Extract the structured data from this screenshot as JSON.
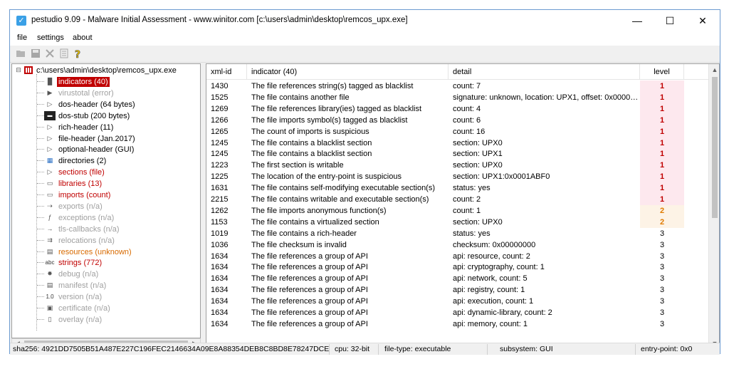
{
  "window": {
    "title": "pestudio 9.09 - Malware Initial Assessment - www.winitor.com [c:\\users\\admin\\desktop\\remcos_upx.exe]",
    "minimize": "—",
    "maximize": "☐",
    "close": "✕"
  },
  "menu": [
    "file",
    "settings",
    "about"
  ],
  "toolbar": {
    "open_icon": "folder-open-icon",
    "save_icon": "save-icon",
    "close_icon": "close-icon",
    "list_icon": "document-icon",
    "help_icon": "help-icon"
  },
  "tree": {
    "root": "c:\\users\\admin\\desktop\\remcos_upx.exe",
    "items": [
      {
        "label": "indicators (40)",
        "color": "red",
        "icon": "bar-icon",
        "selected": true
      },
      {
        "label": "virustotal (error)",
        "color": "grey",
        "icon": "play-icon"
      },
      {
        "label": "dos-header (64 bytes)",
        "color": "black",
        "icon": "arrow-icon"
      },
      {
        "label": "dos-stub (200 bytes)",
        "color": "black",
        "icon": "dos-icon"
      },
      {
        "label": "rich-header (11)",
        "color": "black",
        "icon": "arrow-icon"
      },
      {
        "label": "file-header (Jan.2017)",
        "color": "black",
        "icon": "arrow-icon"
      },
      {
        "label": "optional-header (GUI)",
        "color": "black",
        "icon": "arrow-icon"
      },
      {
        "label": "directories (2)",
        "color": "black",
        "icon": "grid-icon"
      },
      {
        "label": "sections (file)",
        "color": "red",
        "icon": "arrow-icon"
      },
      {
        "label": "libraries (13)",
        "color": "red",
        "icon": "library-icon"
      },
      {
        "label": "imports (count)",
        "color": "red",
        "icon": "library-icon"
      },
      {
        "label": "exports (n/a)",
        "color": "grey",
        "icon": "export-icon"
      },
      {
        "label": "exceptions (n/a)",
        "color": "grey",
        "icon": "exception-icon"
      },
      {
        "label": "tls-callbacks (n/a)",
        "color": "grey",
        "icon": "key-icon"
      },
      {
        "label": "relocations (n/a)",
        "color": "grey",
        "icon": "relocation-icon"
      },
      {
        "label": "resources (unknown)",
        "color": "orange",
        "icon": "resource-icon"
      },
      {
        "label": "strings (772)",
        "color": "red",
        "icon": "abc-icon"
      },
      {
        "label": "debug (n/a)",
        "color": "grey",
        "icon": "bug-icon"
      },
      {
        "label": "manifest (n/a)",
        "color": "grey",
        "icon": "manifest-icon"
      },
      {
        "label": "version (n/a)",
        "color": "grey",
        "icon": "version-icon"
      },
      {
        "label": "certificate (n/a)",
        "color": "grey",
        "icon": "certificate-icon"
      },
      {
        "label": "overlay (n/a)",
        "color": "grey",
        "icon": "page-icon"
      }
    ]
  },
  "table": {
    "columns": [
      "xml-id",
      "indicator (40)",
      "detail",
      "level"
    ],
    "rows": [
      [
        "1430",
        "The file references string(s) tagged as blacklist",
        "count: 7",
        "1"
      ],
      [
        "1525",
        "The file contains another file",
        "signature: unknown, location: UPX1, offset: 0x000061...",
        "1"
      ],
      [
        "1269",
        "The file references library(ies) tagged as blacklist",
        "count: 4",
        "1"
      ],
      [
        "1266",
        "The file imports symbol(s) tagged as blacklist",
        "count: 6",
        "1"
      ],
      [
        "1265",
        "The count of imports is suspicious",
        "count: 16",
        "1"
      ],
      [
        "1245",
        "The file contains a blacklist section",
        "section: UPX0",
        "1"
      ],
      [
        "1245",
        "The file contains a blacklist section",
        "section: UPX1",
        "1"
      ],
      [
        "1223",
        "The first section is writable",
        "section: UPX0",
        "1"
      ],
      [
        "1225",
        "The location of the entry-point is suspicious",
        "section: UPX1:0x0001ABF0",
        "1"
      ],
      [
        "1631",
        "The file contains self-modifying executable section(s)",
        "status: yes",
        "1"
      ],
      [
        "2215",
        "The file contains writable and executable section(s)",
        "count: 2",
        "1"
      ],
      [
        "1262",
        "The file imports anonymous function(s)",
        "count: 1",
        "2"
      ],
      [
        "1153",
        "The file contains a virtualized section",
        "section: UPX0",
        "2"
      ],
      [
        "1019",
        "The file contains a rich-header",
        "status: yes",
        "3"
      ],
      [
        "1036",
        "The file checksum is invalid",
        "checksum: 0x00000000",
        "3"
      ],
      [
        "1634",
        "The file references a group of API",
        "api: resource, count: 2",
        "3"
      ],
      [
        "1634",
        "The file references a group of API",
        "api: cryptography, count: 1",
        "3"
      ],
      [
        "1634",
        "The file references a group of API",
        "api: network, count: 5",
        "3"
      ],
      [
        "1634",
        "The file references a group of API",
        "api: registry, count: 1",
        "3"
      ],
      [
        "1634",
        "The file references a group of API",
        "api: execution, count: 1",
        "3"
      ],
      [
        "1634",
        "The file references a group of API",
        "api: dynamic-library, count: 2",
        "3"
      ],
      [
        "1634",
        "The file references a group of API",
        "api: memory, count: 1",
        "3"
      ]
    ]
  },
  "status": {
    "sha256": "sha256: 4921DD7505B51A487E227C196FEC2146634A09E8A88354DEB8C8BD8E78247DCE",
    "cpu": "cpu: 32-bit",
    "file_type": "file-type: executable",
    "subsystem": "subsystem: GUI",
    "entry_point": "entry-point: 0x0"
  },
  "colors": {
    "red": "#c00000",
    "orange": "#d86a00",
    "grey": "#a0a0a0",
    "level1_bg": "#fde8ee",
    "level2_bg": "#fdf3e6"
  }
}
